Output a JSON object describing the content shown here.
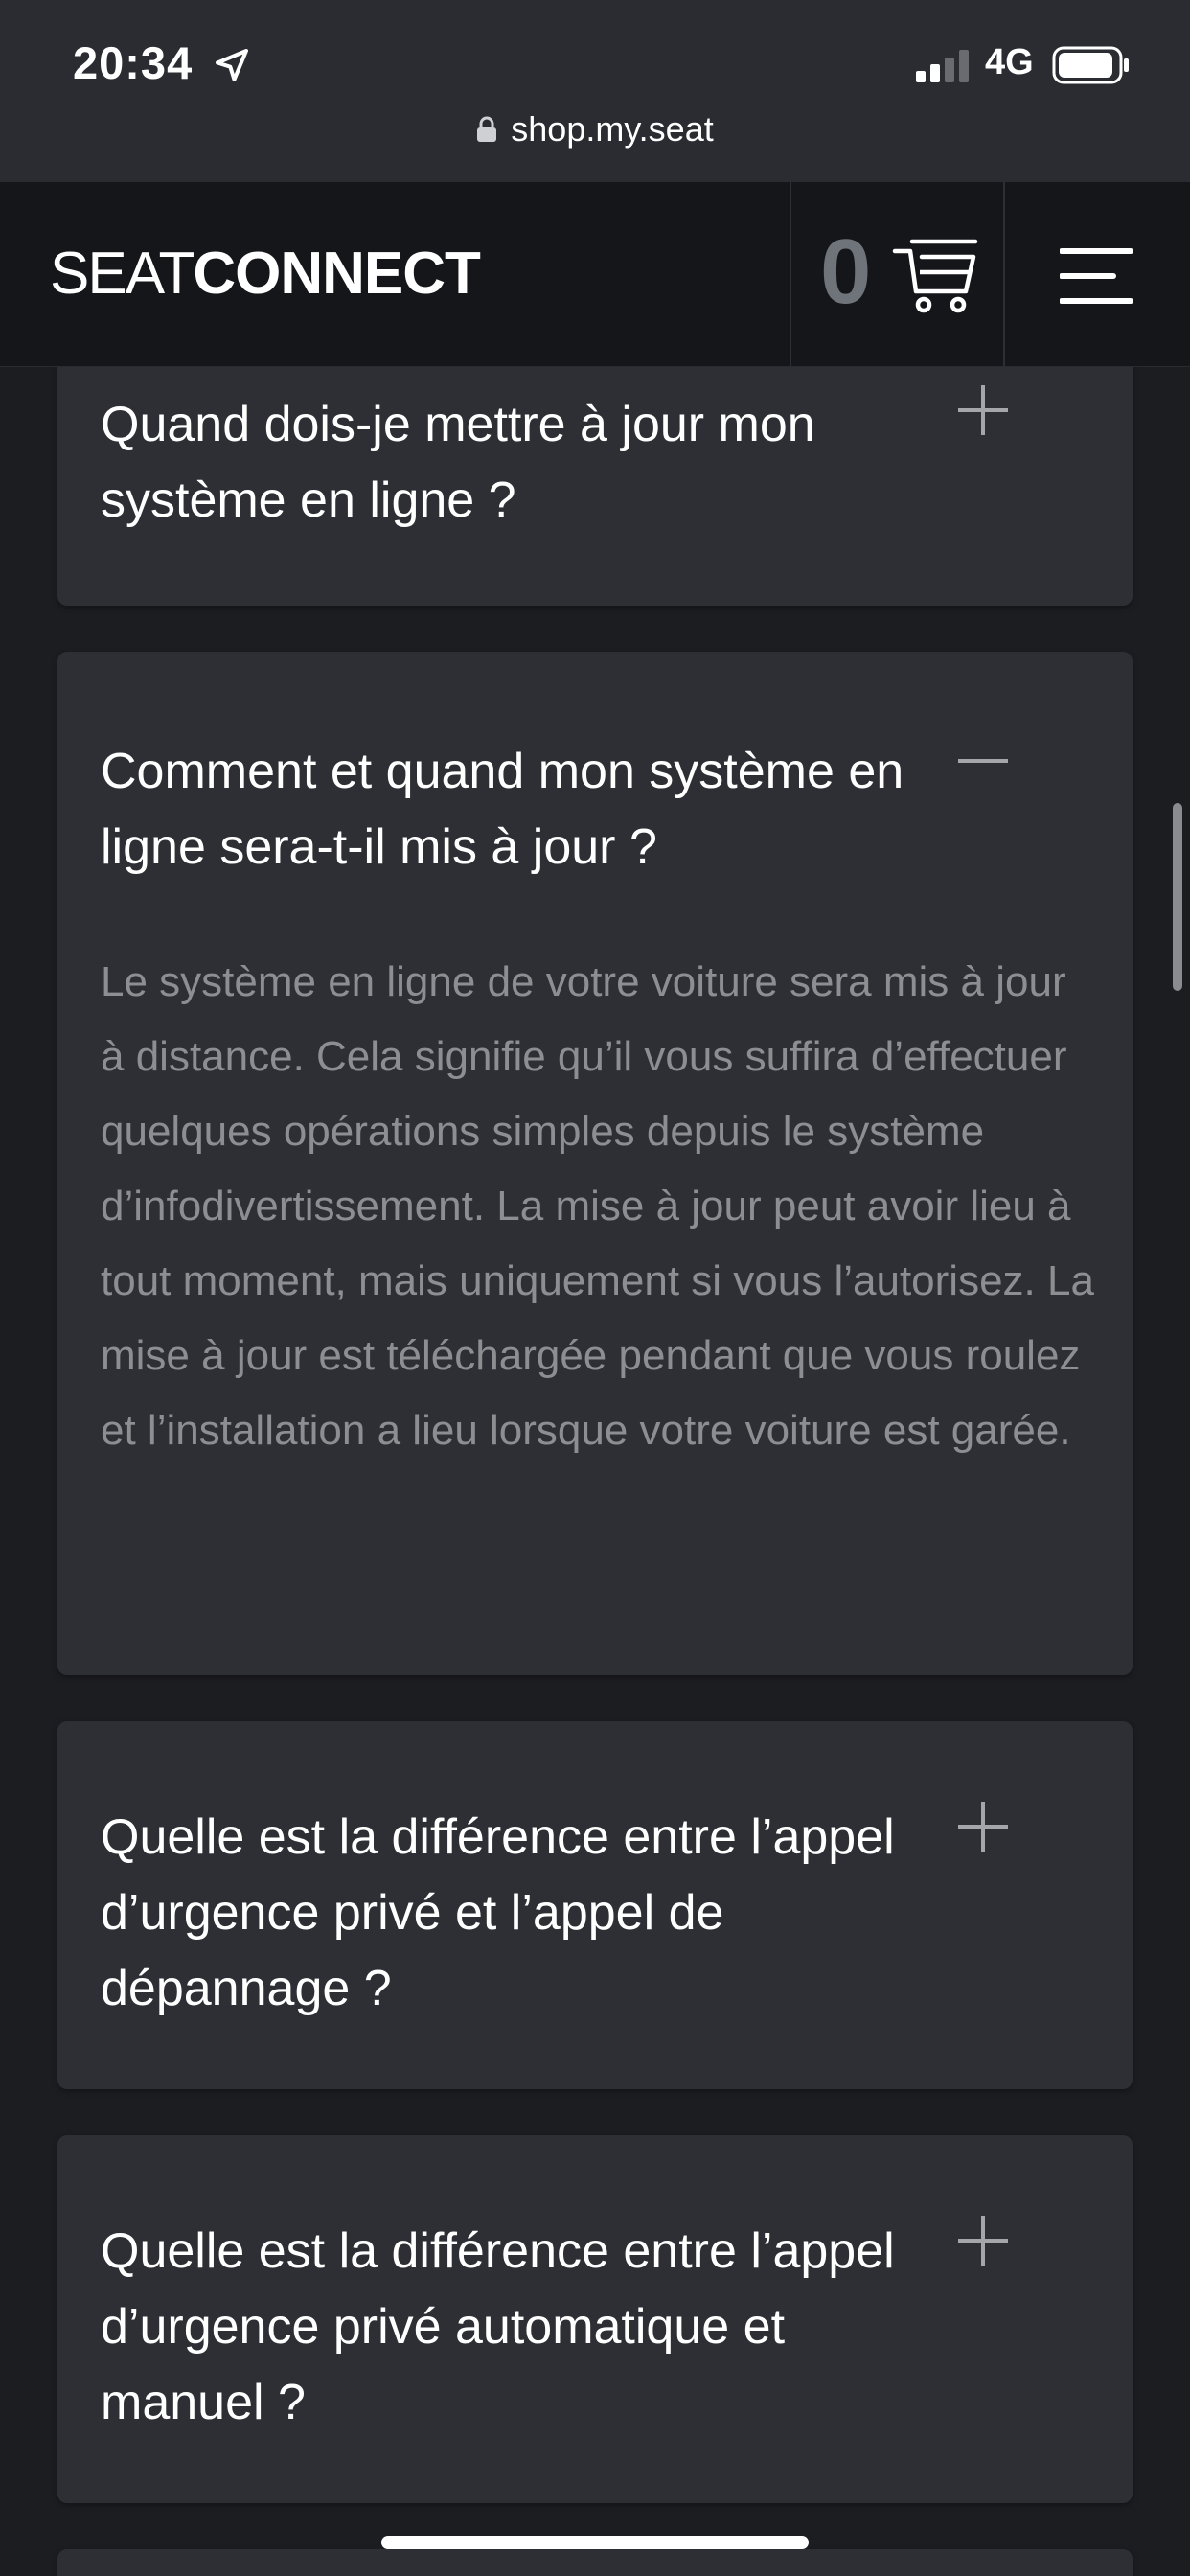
{
  "status_bar": {
    "time": "20:34",
    "network": "4G"
  },
  "browser": {
    "url": "shop.my.seat"
  },
  "header": {
    "logo_light": "SEAT",
    "logo_bold": "CONNECT",
    "cart_count": "0"
  },
  "faq": {
    "items": [
      {
        "question": "Quand dois-je mettre à jour mon système en ligne ?",
        "expanded": false
      },
      {
        "question": "Comment et quand mon système en ligne sera-t-il mis à jour ?",
        "expanded": true,
        "answer": "Le système en ligne de votre voiture sera mis à jour à distance. Cela signifie qu’il vous suffira d’effectuer quelques opérations simples depuis le système d’infodivertissement. La mise à jour peut avoir lieu à tout moment, mais uniquement si vous l’autorisez. La mise à jour est téléchargée pendant que vous roulez et l’installation a lieu lorsque votre voiture est garée."
      },
      {
        "question": "Quelle est la différence entre l’appel d’urgence privé et l’appel de dépannage ?",
        "expanded": false
      },
      {
        "question": "Quelle est la différence entre l’appel d’urgence privé automatique et manuel ?",
        "expanded": false
      }
    ]
  },
  "colors": {
    "background": "#1c1d21",
    "card": "#2e2f34",
    "header": "#15161a",
    "answer_text": "#8d8e92",
    "cart_count": "#6e747a"
  },
  "icons": {
    "location": "location-arrow-icon",
    "signal": "cellular-signal-icon",
    "battery": "battery-icon",
    "lock": "lock-icon",
    "cart": "shopping-cart-icon",
    "menu": "hamburger-menu-icon",
    "expand": "plus-icon",
    "collapse": "minus-icon"
  }
}
